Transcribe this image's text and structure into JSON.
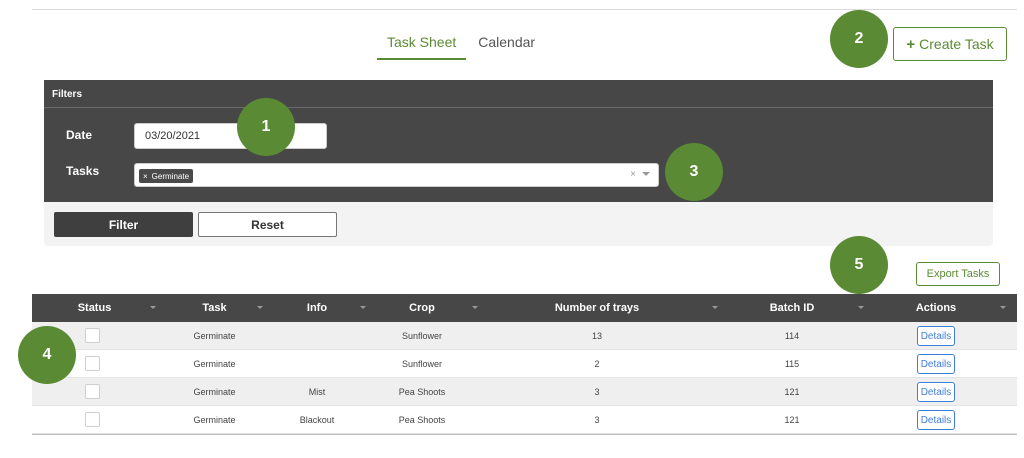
{
  "tabs": [
    {
      "label": "Task Sheet",
      "active": true
    },
    {
      "label": "Calendar",
      "active": false
    }
  ],
  "create_task": {
    "label": "Create Task",
    "icon": "plus-icon"
  },
  "filters": {
    "header": "Filters",
    "date_label": "Date",
    "date_value": "03/20/2021",
    "tasks_label": "Tasks",
    "selected_tasks": [
      {
        "label": "Germinate"
      }
    ],
    "clear_symbol": "×",
    "filter_button": "Filter",
    "reset_button": "Reset"
  },
  "export_tasks": "Export Tasks",
  "table": {
    "columns": [
      "Status",
      "Task",
      "Info",
      "Crop",
      "Number of trays",
      "Batch ID",
      "Actions"
    ],
    "rows": [
      {
        "task": "Germinate",
        "info": "",
        "crop": "Sunflower",
        "trays": "13",
        "batch": "114",
        "action": "Details"
      },
      {
        "task": "Germinate",
        "info": "",
        "crop": "Sunflower",
        "trays": "2",
        "batch": "115",
        "action": "Details"
      },
      {
        "task": "Germinate",
        "info": "Mist",
        "crop": "Pea Shoots",
        "trays": "3",
        "batch": "121",
        "action": "Details"
      },
      {
        "task": "Germinate",
        "info": "Blackout",
        "crop": "Pea Shoots",
        "trays": "3",
        "batch": "121",
        "action": "Details"
      }
    ]
  },
  "callouts": [
    "1",
    "2",
    "3",
    "4",
    "5"
  ],
  "colors": {
    "accent": "#5b8a34",
    "dark_panel": "#474747",
    "link": "#3d7fd6"
  }
}
